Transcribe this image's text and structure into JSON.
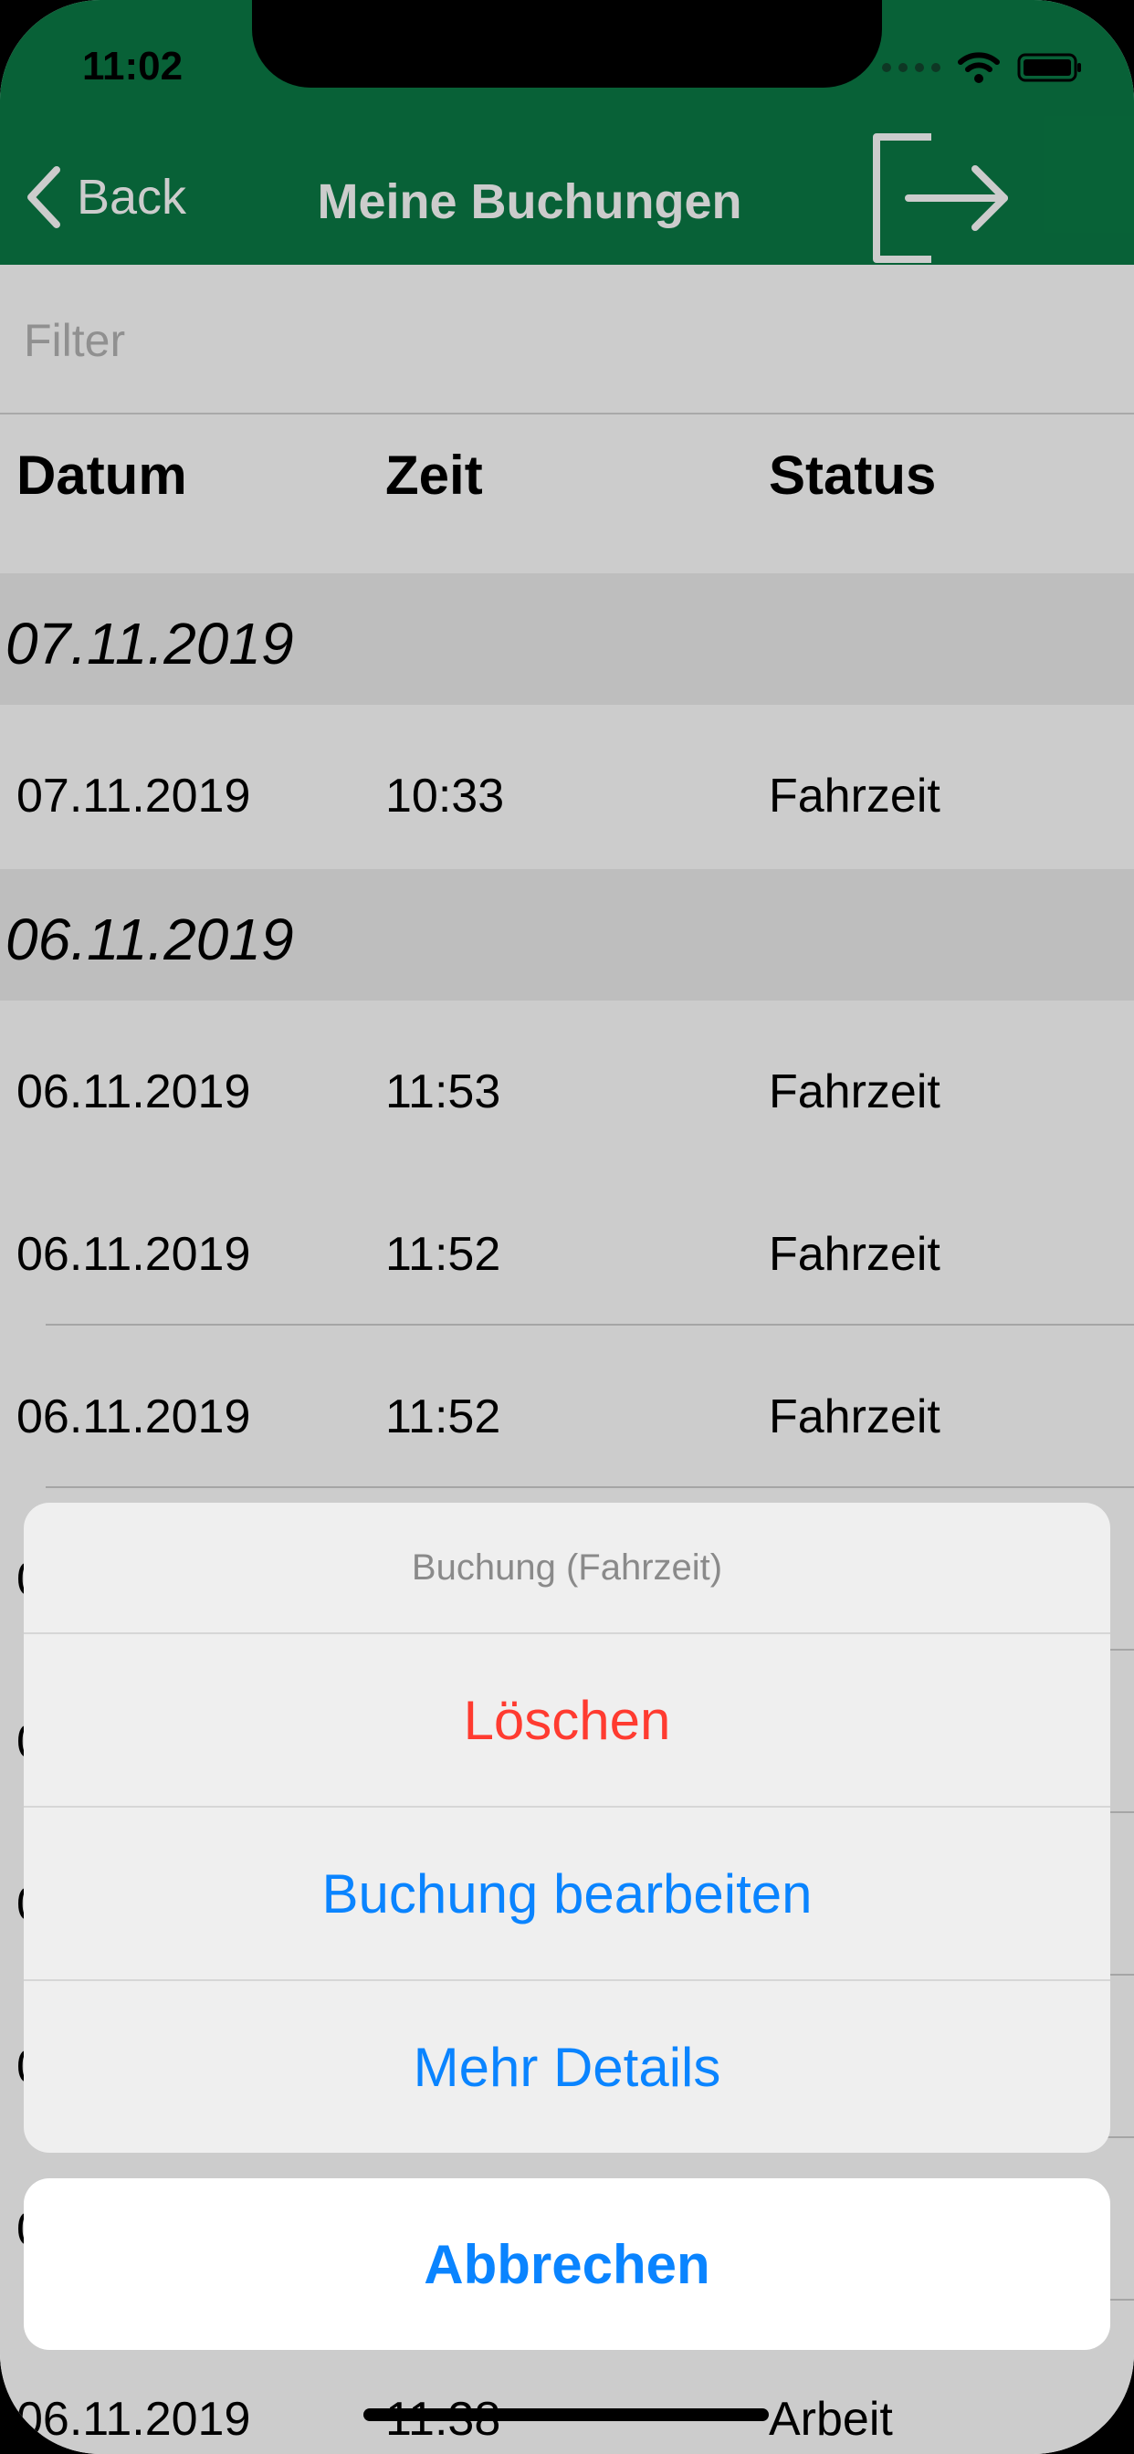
{
  "status": {
    "time": "11:02"
  },
  "nav": {
    "back_label": "Back",
    "title": "Meine Buchungen"
  },
  "filter": {
    "placeholder": "Filter",
    "value": ""
  },
  "table": {
    "headers": [
      "Datum",
      "Zeit",
      "Status"
    ],
    "sections": [
      {
        "label": "07.11.2019",
        "rows": [
          [
            "07.11.2019",
            "10:33",
            "Fahrzeit"
          ]
        ]
      },
      {
        "label": "06.11.2019",
        "rows": [
          [
            "06.11.2019",
            "11:53",
            "Fahrzeit"
          ],
          [
            "06.11.2019",
            "11:52",
            "Fahrzeit"
          ],
          [
            "06.11.2019",
            "11:52",
            "Fahrzeit"
          ]
        ]
      }
    ],
    "partial_rows": [
      "0",
      "0",
      "0",
      "0",
      "0"
    ],
    "bottom_row": [
      "06.11.2019",
      "11:38",
      "Arbeit"
    ]
  },
  "action_sheet": {
    "title": "Buchung (Fahrzeit)",
    "delete_label": "Löschen",
    "edit_label": "Buchung bearbeiten",
    "details_label": "Mehr Details",
    "cancel_label": "Abbrechen"
  },
  "colors": {
    "header_green": "#0a7a45",
    "destructive_red": "#ff3b30",
    "action_blue": "#0a84ff"
  },
  "icons": {
    "back": "chevron-left-icon",
    "logout": "logout-icon",
    "wifi": "wifi-icon",
    "battery": "battery-icon"
  }
}
